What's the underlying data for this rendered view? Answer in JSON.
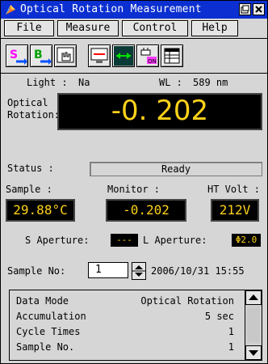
{
  "window": {
    "title": "Optical Rotation Measurement",
    "controls": [
      "restore-icon",
      "close-icon"
    ]
  },
  "menu": [
    "File",
    "Measure",
    "Control",
    "Help"
  ],
  "toolbar": [
    {
      "icon": "s-arrow-icon"
    },
    {
      "icon": "b-arrow-icon"
    },
    {
      "icon": "hand-cursor-icon"
    },
    {
      "icon": "screen-target-icon"
    },
    {
      "icon": "cross-arrows-icon",
      "active": true
    },
    {
      "icon": "lamp-on-icon"
    },
    {
      "icon": "table-icon"
    }
  ],
  "light": {
    "label": "Light :",
    "value": "Na"
  },
  "wl": {
    "label": "WL :",
    "value": "589 nm"
  },
  "optical_rotation": {
    "label_line1": "Optical",
    "label_line2": "Rotation:",
    "value": "-0. 202"
  },
  "status": {
    "label": "Status :",
    "value": "Ready"
  },
  "sample": {
    "label": "Sample :",
    "value": "29.88°C"
  },
  "monitor": {
    "label": "Monitor :",
    "value": "-0.202"
  },
  "ht_volt": {
    "label": "HT Volt :",
    "value": "212V"
  },
  "s_aperture": {
    "label": "S Aperture:",
    "value": "---"
  },
  "l_aperture": {
    "label": "L Aperture:",
    "value": "Φ2.0"
  },
  "sample_no": {
    "label": "Sample No:",
    "value": "1"
  },
  "datetime": "2006/10/31 15:55",
  "info_rows": [
    {
      "key": "Data Mode",
      "value": "Optical Rotation"
    },
    {
      "key": "Accumulation",
      "value": "5 sec"
    },
    {
      "key": "Cycle Times",
      "value": "1"
    },
    {
      "key": "Sample No.",
      "value": "1"
    }
  ]
}
